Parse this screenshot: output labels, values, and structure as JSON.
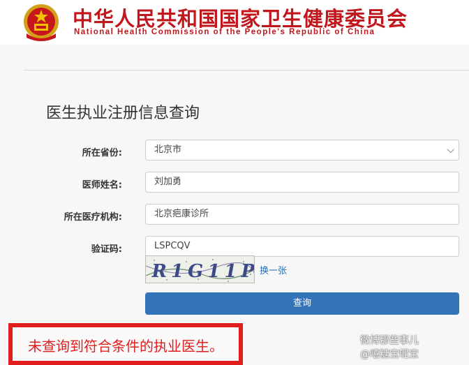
{
  "header": {
    "title_cn": "中华人民共和国国家卫生健康委员会",
    "title_en": "National Health Commission of the People's Republic of China"
  },
  "page_title": "医生执业注册信息查询",
  "form": {
    "province": {
      "label": "所在省份:",
      "value": "北京市"
    },
    "doctor_name": {
      "label": "医师姓名:",
      "value": "刘加勇"
    },
    "institution": {
      "label": "所在医疗机构:",
      "value": "北京疤康诊所"
    },
    "captcha": {
      "label": "验证码:",
      "value": "LSPCQV",
      "image_text": "R1G11P",
      "refresh_label": "换一张"
    },
    "submit_label": "查询"
  },
  "result_text": "未查询到符合条件的执业医生。",
  "watermark": {
    "line1": "微博那些事儿",
    "line2": "@嘻糖宝呢宝"
  },
  "colors": {
    "brand_red": "#c2161d",
    "button_blue": "#3374b9",
    "link_blue": "#2a6fb8",
    "highlight_red": "#e01e1e"
  },
  "icons": {
    "emblem": "national-emblem-icon",
    "dropdown": "chevron-down-icon"
  }
}
